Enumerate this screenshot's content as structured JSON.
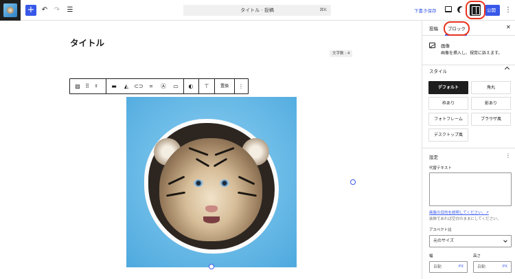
{
  "topbar": {
    "command_label": "タイトル · 投稿",
    "command_shortcut": "⌘K",
    "save_draft": "下書き保存",
    "publish": "公開"
  },
  "editor": {
    "post_title": "タイトル",
    "char_count": "文字数 : 4",
    "toolbar_replace": "置換"
  },
  "sidebar": {
    "tab_post": "投稿",
    "tab_block": "ブロック",
    "block_name": "画像",
    "block_description": "画像を挿入し、視覚に訴えます。",
    "styles_heading": "スタイル",
    "styles": [
      "デフォルト",
      "角丸",
      "枠あり",
      "影あり",
      "フォトフレーム",
      "ブラウザ風",
      "デスクトップ風"
    ],
    "settings_heading": "設定",
    "alt_label": "代替テキスト",
    "alt_link": "画像の目的を説明してください。↗",
    "alt_help": "装飾であれば空白のままにしてください。",
    "aspect_label": "アスペクト比",
    "aspect_value": "元のサイズ",
    "width_label": "幅",
    "height_label": "高さ",
    "auto": "自動",
    "unit": "PX"
  },
  "colors": {
    "accent": "#3858e9",
    "annotation": "#e8321e"
  }
}
